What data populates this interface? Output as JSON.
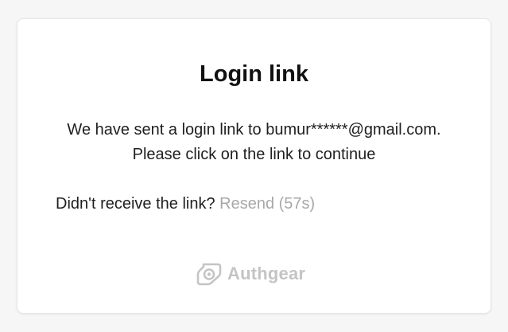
{
  "card": {
    "title": "Login link",
    "message_line1": "We have sent a login link to bumur******@gmail.com.",
    "message_line2": "Please click on the link to continue",
    "resend_prompt": "Didn't receive the link?",
    "resend_label": "Resend (57s)"
  },
  "footer": {
    "brand_name": "Authgear",
    "brand_icon": "authgear-logo-icon"
  },
  "colors": {
    "background": "#f6f6f6",
    "card": "#ffffff",
    "text": "#1f1f1f",
    "disabled_link": "#a8a8a8",
    "brand": "#c4c4c4"
  }
}
